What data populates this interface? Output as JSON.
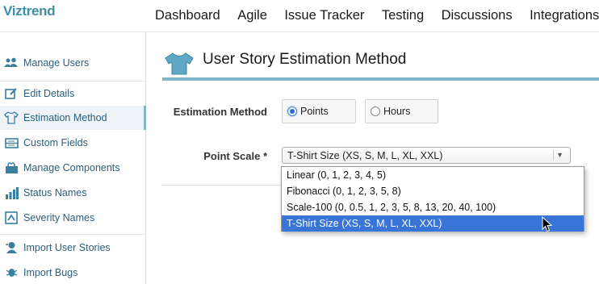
{
  "brand": "Viztrend",
  "nav": [
    "Dashboard",
    "Agile",
    "Issue Tracker",
    "Testing",
    "Discussions",
    "Integrations"
  ],
  "sidebar": {
    "items": [
      {
        "label": "Manage Users",
        "icon": "users-icon"
      },
      {
        "label": "Edit Details",
        "icon": "edit-icon"
      },
      {
        "label": "Estimation Method",
        "icon": "tshirt-icon",
        "active": true
      },
      {
        "label": "Custom Fields",
        "icon": "fields-icon"
      },
      {
        "label": "Manage Components",
        "icon": "components-icon"
      },
      {
        "label": "Status Names",
        "icon": "bars-icon"
      },
      {
        "label": "Severity Names",
        "icon": "severity-icon"
      },
      {
        "label": "Import User Stories",
        "icon": "import-stories-icon"
      },
      {
        "label": "Import Bugs",
        "icon": "import-bugs-icon"
      }
    ]
  },
  "page": {
    "title": "User Story Estimation Method",
    "estimation_label": "Estimation Method",
    "options": [
      {
        "label": "Points",
        "checked": true
      },
      {
        "label": "Hours",
        "checked": false
      }
    ],
    "point_scale_label": "Point Scale *",
    "point_scale_value": "T-Shirt Size (XS, S, M, L, XL, XXL)",
    "point_scale_options": [
      "Linear (0, 1, 2, 3, 4, 5)",
      "Fibonacci (0, 1, 2, 3, 5, 8)",
      "Scale-100 (0, 0.5, 1, 2, 3, 5, 8, 13, 20, 40, 100)",
      "T-Shirt Size (XS, S, M, L, XL, XXL)"
    ],
    "selected_option_index": 3
  },
  "colors": {
    "accent": "#7fb6cc",
    "brand": "#3d8ea8",
    "selection": "#3875d7",
    "link": "#2a5f7c"
  }
}
